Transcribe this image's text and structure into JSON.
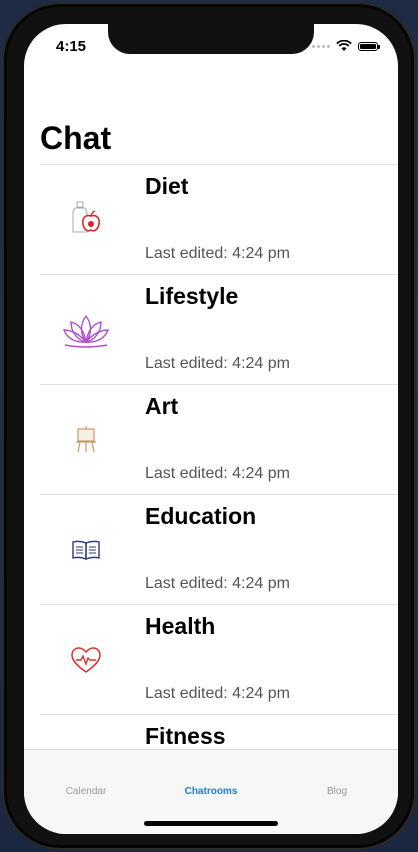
{
  "status": {
    "time": "4:15"
  },
  "header": {
    "title": "Chat"
  },
  "rooms": [
    {
      "title": "Diet",
      "subtitle": "Last edited: 4:24 pm",
      "icon": "apple-bottle-icon"
    },
    {
      "title": "Lifestyle",
      "subtitle": "Last edited: 4:24 pm",
      "icon": "lotus-icon"
    },
    {
      "title": "Art",
      "subtitle": "Last edited: 4:24 pm",
      "icon": "easel-icon"
    },
    {
      "title": "Education",
      "subtitle": "Last edited: 4:24 pm",
      "icon": "book-icon"
    },
    {
      "title": "Health",
      "subtitle": "Last edited: 4:24 pm",
      "icon": "heart-pulse-icon"
    },
    {
      "title": "Fitness",
      "subtitle": "",
      "icon": "dumbbell-icon"
    }
  ],
  "tabs": [
    {
      "label": "Calendar",
      "active": false
    },
    {
      "label": "Chatrooms",
      "active": true
    },
    {
      "label": "Blog",
      "active": false
    }
  ],
  "colors": {
    "active_tab": "#1a7fd6",
    "diet_icon": "#d82626",
    "lifestyle_icon": "#b04fd0",
    "art_icon": "#c59b6a",
    "education_icon": "#2f3b73",
    "health_icon": "#d83030"
  }
}
